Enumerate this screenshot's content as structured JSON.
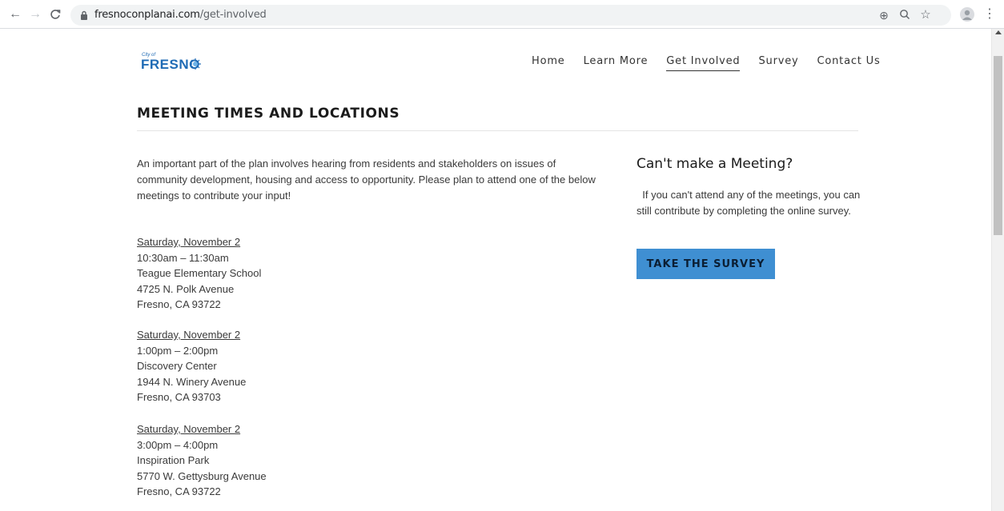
{
  "browser": {
    "url_domain": "fresnoconplanai.com",
    "url_path": "/get-involved",
    "back_icon": "←",
    "forward_icon": "→",
    "reload_icon": "C",
    "zoom_icon": "⊕",
    "search_icon": "⚲",
    "star_icon": "☆",
    "menu_icon": "⋮"
  },
  "logo": {
    "city_text": "City of",
    "name": "FRESNO"
  },
  "nav": {
    "items": [
      {
        "label": "Home"
      },
      {
        "label": "Learn More"
      },
      {
        "label": "Get Involved"
      },
      {
        "label": "Survey"
      },
      {
        "label": "Contact Us"
      }
    ]
  },
  "main": {
    "title": "MEETING TIMES AND LOCATIONS",
    "intro": "An important part of the plan involves hearing from residents  and  stakeholders on issues of community development, housing and access to  opportunity.  Please plan to attend one of the below meetings to contribute your input!",
    "meetings": [
      {
        "date": "Saturday, November 2",
        "time": "10:30am – 11:30am",
        "place": "Teague  Elementary School",
        "address": "4725 N. Polk Avenue",
        "city": "Fresno, CA 93722"
      },
      {
        "date": "Saturday, November 2",
        "time": "1:00pm – 2:00pm",
        "place": "Discovery Center",
        "address": "1944 N. Winery Avenue",
        "city": "Fresno, CA 93703"
      },
      {
        "date": "Saturday, November 2",
        "time": "3:00pm – 4:00pm",
        "place": "Inspiration Park",
        "address": "5770 W. Gettysburg Avenue",
        "city": "Fresno, CA 93722"
      }
    ]
  },
  "sidebar": {
    "heading": "Can't make a Meeting?",
    "text": "  If you can't attend any of the meetings, you can still contribute by completing the online survey.",
    "button_label": "TAKE THE SURVEY"
  },
  "colors": {
    "brand_blue": "#1f6bb5",
    "button_blue": "#3f8fd2"
  }
}
